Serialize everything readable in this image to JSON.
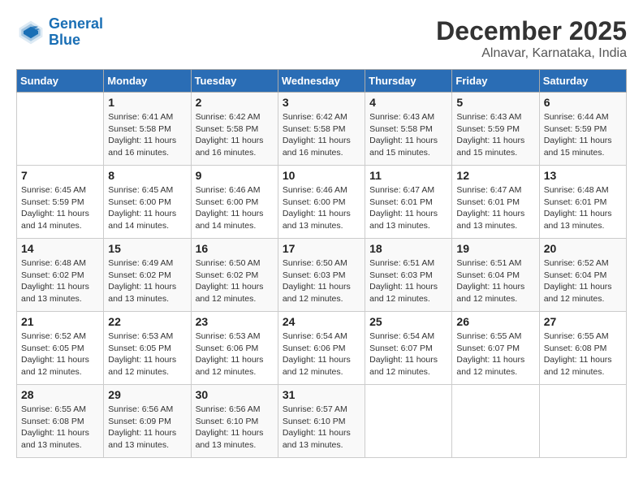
{
  "header": {
    "logo_line1": "General",
    "logo_line2": "Blue",
    "month": "December 2025",
    "location": "Alnavar, Karnataka, India"
  },
  "weekdays": [
    "Sunday",
    "Monday",
    "Tuesday",
    "Wednesday",
    "Thursday",
    "Friday",
    "Saturday"
  ],
  "weeks": [
    [
      {
        "day": "",
        "info": ""
      },
      {
        "day": "1",
        "info": "Sunrise: 6:41 AM\nSunset: 5:58 PM\nDaylight: 11 hours\nand 16 minutes."
      },
      {
        "day": "2",
        "info": "Sunrise: 6:42 AM\nSunset: 5:58 PM\nDaylight: 11 hours\nand 16 minutes."
      },
      {
        "day": "3",
        "info": "Sunrise: 6:42 AM\nSunset: 5:58 PM\nDaylight: 11 hours\nand 16 minutes."
      },
      {
        "day": "4",
        "info": "Sunrise: 6:43 AM\nSunset: 5:58 PM\nDaylight: 11 hours\nand 15 minutes."
      },
      {
        "day": "5",
        "info": "Sunrise: 6:43 AM\nSunset: 5:59 PM\nDaylight: 11 hours\nand 15 minutes."
      },
      {
        "day": "6",
        "info": "Sunrise: 6:44 AM\nSunset: 5:59 PM\nDaylight: 11 hours\nand 15 minutes."
      }
    ],
    [
      {
        "day": "7",
        "info": "Sunrise: 6:45 AM\nSunset: 5:59 PM\nDaylight: 11 hours\nand 14 minutes."
      },
      {
        "day": "8",
        "info": "Sunrise: 6:45 AM\nSunset: 6:00 PM\nDaylight: 11 hours\nand 14 minutes."
      },
      {
        "day": "9",
        "info": "Sunrise: 6:46 AM\nSunset: 6:00 PM\nDaylight: 11 hours\nand 14 minutes."
      },
      {
        "day": "10",
        "info": "Sunrise: 6:46 AM\nSunset: 6:00 PM\nDaylight: 11 hours\nand 13 minutes."
      },
      {
        "day": "11",
        "info": "Sunrise: 6:47 AM\nSunset: 6:01 PM\nDaylight: 11 hours\nand 13 minutes."
      },
      {
        "day": "12",
        "info": "Sunrise: 6:47 AM\nSunset: 6:01 PM\nDaylight: 11 hours\nand 13 minutes."
      },
      {
        "day": "13",
        "info": "Sunrise: 6:48 AM\nSunset: 6:01 PM\nDaylight: 11 hours\nand 13 minutes."
      }
    ],
    [
      {
        "day": "14",
        "info": "Sunrise: 6:48 AM\nSunset: 6:02 PM\nDaylight: 11 hours\nand 13 minutes."
      },
      {
        "day": "15",
        "info": "Sunrise: 6:49 AM\nSunset: 6:02 PM\nDaylight: 11 hours\nand 13 minutes."
      },
      {
        "day": "16",
        "info": "Sunrise: 6:50 AM\nSunset: 6:02 PM\nDaylight: 11 hours\nand 12 minutes."
      },
      {
        "day": "17",
        "info": "Sunrise: 6:50 AM\nSunset: 6:03 PM\nDaylight: 11 hours\nand 12 minutes."
      },
      {
        "day": "18",
        "info": "Sunrise: 6:51 AM\nSunset: 6:03 PM\nDaylight: 11 hours\nand 12 minutes."
      },
      {
        "day": "19",
        "info": "Sunrise: 6:51 AM\nSunset: 6:04 PM\nDaylight: 11 hours\nand 12 minutes."
      },
      {
        "day": "20",
        "info": "Sunrise: 6:52 AM\nSunset: 6:04 PM\nDaylight: 11 hours\nand 12 minutes."
      }
    ],
    [
      {
        "day": "21",
        "info": "Sunrise: 6:52 AM\nSunset: 6:05 PM\nDaylight: 11 hours\nand 12 minutes."
      },
      {
        "day": "22",
        "info": "Sunrise: 6:53 AM\nSunset: 6:05 PM\nDaylight: 11 hours\nand 12 minutes."
      },
      {
        "day": "23",
        "info": "Sunrise: 6:53 AM\nSunset: 6:06 PM\nDaylight: 11 hours\nand 12 minutes."
      },
      {
        "day": "24",
        "info": "Sunrise: 6:54 AM\nSunset: 6:06 PM\nDaylight: 11 hours\nand 12 minutes."
      },
      {
        "day": "25",
        "info": "Sunrise: 6:54 AM\nSunset: 6:07 PM\nDaylight: 11 hours\nand 12 minutes."
      },
      {
        "day": "26",
        "info": "Sunrise: 6:55 AM\nSunset: 6:07 PM\nDaylight: 11 hours\nand 12 minutes."
      },
      {
        "day": "27",
        "info": "Sunrise: 6:55 AM\nSunset: 6:08 PM\nDaylight: 11 hours\nand 12 minutes."
      }
    ],
    [
      {
        "day": "28",
        "info": "Sunrise: 6:55 AM\nSunset: 6:08 PM\nDaylight: 11 hours\nand 13 minutes."
      },
      {
        "day": "29",
        "info": "Sunrise: 6:56 AM\nSunset: 6:09 PM\nDaylight: 11 hours\nand 13 minutes."
      },
      {
        "day": "30",
        "info": "Sunrise: 6:56 AM\nSunset: 6:10 PM\nDaylight: 11 hours\nand 13 minutes."
      },
      {
        "day": "31",
        "info": "Sunrise: 6:57 AM\nSunset: 6:10 PM\nDaylight: 11 hours\nand 13 minutes."
      },
      {
        "day": "",
        "info": ""
      },
      {
        "day": "",
        "info": ""
      },
      {
        "day": "",
        "info": ""
      }
    ]
  ]
}
